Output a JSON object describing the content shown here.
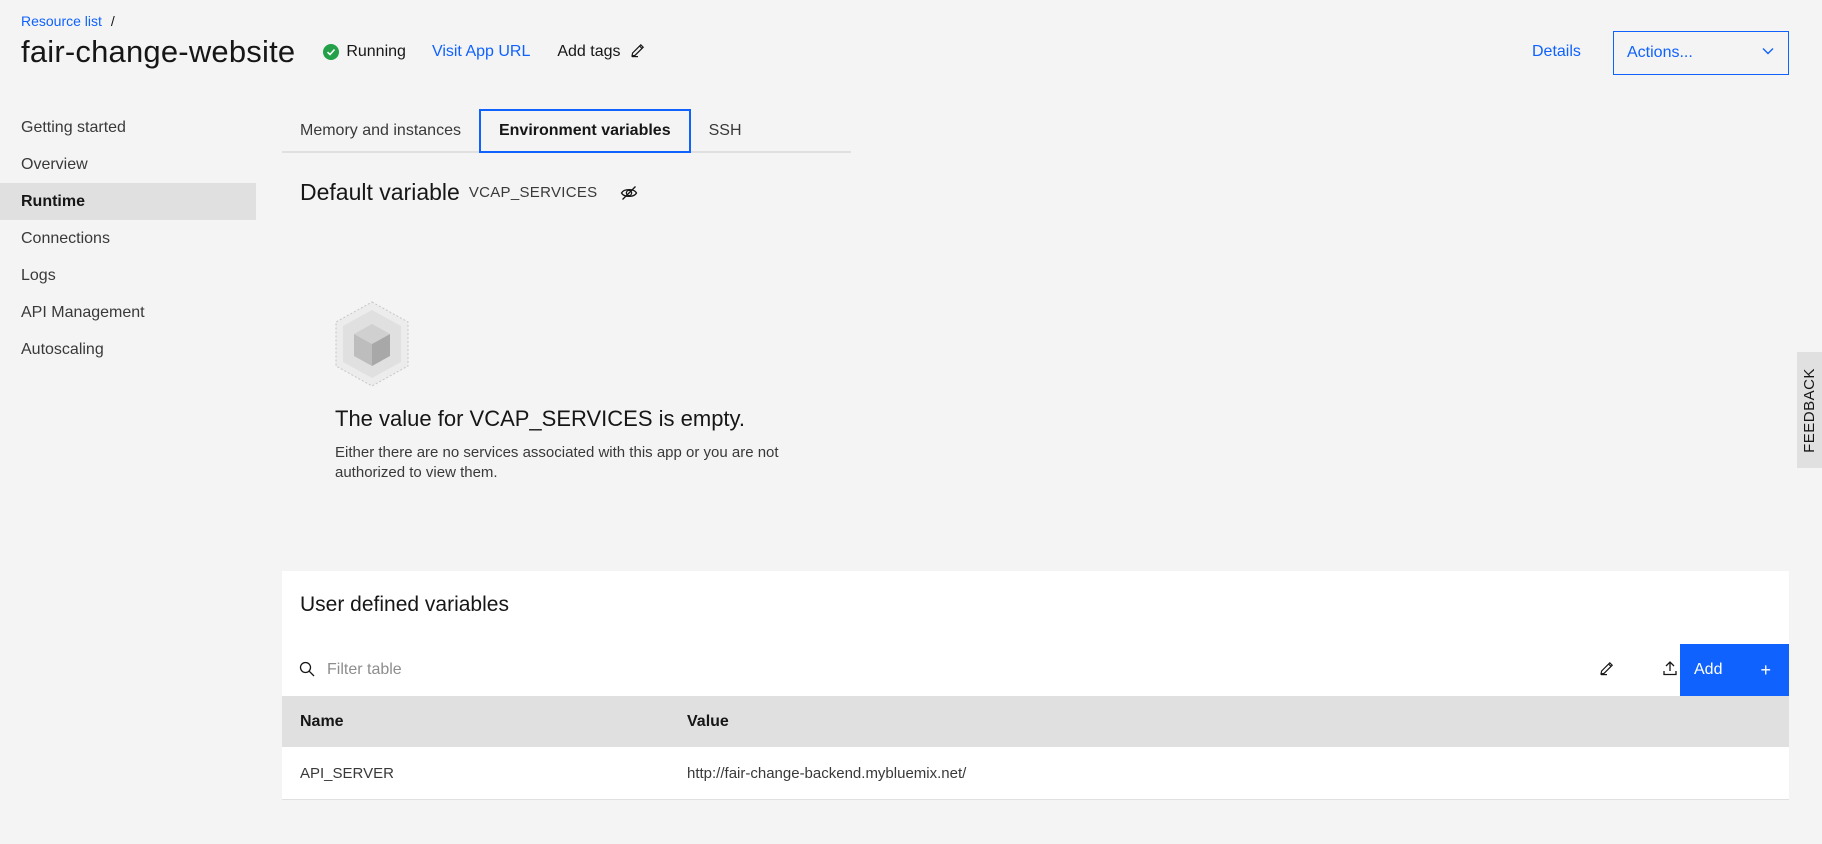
{
  "breadcrumb": {
    "link": "Resource list",
    "separator": "/"
  },
  "header": {
    "title": "fair-change-website",
    "status": "Running",
    "visit_link": "Visit App URL",
    "add_tags": "Add tags",
    "details_link": "Details",
    "actions_label": "Actions..."
  },
  "sidebar": {
    "items": [
      {
        "label": "Getting started"
      },
      {
        "label": "Overview"
      },
      {
        "label": "Runtime",
        "active": true
      },
      {
        "label": "Connections"
      },
      {
        "label": "Logs"
      },
      {
        "label": "API Management"
      },
      {
        "label": "Autoscaling"
      }
    ]
  },
  "tabs": [
    {
      "label": "Memory and instances"
    },
    {
      "label": "Environment variables",
      "active": true
    },
    {
      "label": "SSH"
    }
  ],
  "default_variable": {
    "label": "Default variable",
    "name": "VCAP_SERVICES"
  },
  "empty_state": {
    "title": "The value for VCAP_SERVICES is empty.",
    "description": "Either there are no services associated with this app or you are not authorized to view them."
  },
  "user_defined": {
    "title": "User defined variables",
    "filter_placeholder": "Filter table",
    "add_label": "Add",
    "add_symbol": "+",
    "columns": [
      "Name",
      "Value"
    ],
    "rows": [
      {
        "name": "API_SERVER",
        "value": "http://fair-change-backend.mybluemix.net/"
      }
    ]
  },
  "feedback": "FEEDBACK",
  "colors": {
    "accent": "#0f62fe",
    "success": "#24a148",
    "background": "#f4f4f4",
    "panel": "#ffffff",
    "header_row": "#e0e0e0"
  }
}
